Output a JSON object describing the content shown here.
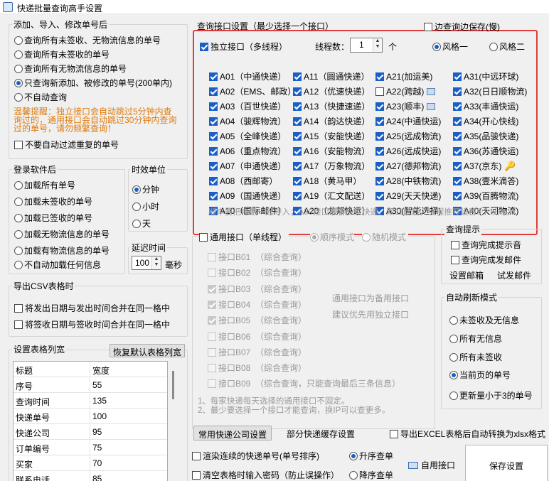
{
  "window": {
    "title": "快递批量查询高手设置"
  },
  "add": {
    "legend": "添加、导入、修改单号后",
    "options": [
      "查询所有未签收、无物流信息的单号",
      "查询所有未签收的单号",
      "查询所有无物流信息的单号",
      "只查询新添加、被修改的单号(200单内)",
      "不自动查询"
    ],
    "selected": 3,
    "warning": [
      "温馨提醒：独立接口会自动跳过5分钟内查",
      "询过的，通用接口会自动跳过30分钟内查询",
      "过的单号，请勿频繁查询！"
    ],
    "nofilter": "不要自动过滤重复的单号"
  },
  "login": {
    "legend": "登录软件后",
    "options": [
      "加载所有单号",
      "加载未签收的单号",
      "加载已签收的单号",
      "加载无物流信息的单号",
      "加载有物流信息的单号",
      "不自动加载任何信息"
    ]
  },
  "timeunit": {
    "legend": "时效单位",
    "options": [
      "分钟",
      "小时",
      "天"
    ],
    "selected": 0
  },
  "delay": {
    "legend": "延迟时间",
    "value": "100",
    "unit": "毫秒"
  },
  "csv": {
    "legend": "导出CSV表格时",
    "options": [
      "将发出日期与发出时间合并在同一格中",
      "将签收日期与签收时间合并在同一格中"
    ]
  },
  "colwidth": {
    "legend": "设置表格列宽",
    "reset": "恢复默认表格列宽",
    "headers": [
      "标题",
      "宽度"
    ],
    "rows": [
      [
        "序号",
        "55"
      ],
      [
        "查询时间",
        "135"
      ],
      [
        "快递单号",
        "100"
      ],
      [
        "快递公司",
        "95"
      ],
      [
        "订单编号",
        "75"
      ],
      [
        "买家",
        "70"
      ],
      [
        "联系电话",
        "85"
      ]
    ]
  },
  "api": {
    "legend": "查询接口设置（最少选择一个接口）",
    "saveWhileQuery": "边查询边保存(慢)",
    "independent": "独立接口（多线程）",
    "threadsLabel": "线程数：",
    "threads": "1",
    "threadsUnit": "个",
    "style1": "风格一",
    "style2": "风格二",
    "col1": [
      "A01（中通快递）",
      "A02（EMS、邮政）",
      "A03（百世快递）",
      "A04（骏辉物流）",
      "A05（全峰快递）",
      "A06（重点物流）",
      "A07（申通快递）",
      "A08（西邮寄）",
      "A09（国通快递）",
      "A10（国际邮件）"
    ],
    "col2": [
      "A11（圆通快递）",
      "A12（优速快递）",
      "A13（快捷速递）",
      "A14（韵达快递）",
      "A15（安能快递）",
      "A16（安能物流）",
      "A17（万象物流）",
      "A18（黄马甲）",
      "A19（汇文配送）",
      "A20（龙邦快运）"
    ],
    "col3": [
      "A21(加运美)",
      "A22(跨越)",
      "A23(顺丰)",
      "A24(中通快运)",
      "A25(远成物流)",
      "A26(远成快运)",
      "A27(德邦物流)",
      "A28(中铁物流)",
      "A29(天天快递)",
      "A30(智能选择)"
    ],
    "col4": [
      "A31(中远环球)",
      "A32(日日顺物流)",
      "A33(丰通快运)",
      "A34(开心快线)",
      "A35(品骏快递)",
      "A36(苏通快运)",
      "A37(京东)",
      "A38(壹米滴答)",
      "A39(百腾物流)",
      "A40(天河物流)"
    ],
    "note": "顺丰要把电话一起导入；A30接口兼容多家快递。双11前后，线程推荐设置5个以内。"
  },
  "general": {
    "label": "通用接口（单线程）",
    "mode1": "顺序模式",
    "mode2": "随机模式",
    "items": [
      "接口B01  （综合查询）",
      "接口B02  （综合查询）",
      "接口B03  （综合查询）",
      "接口B04  （综合查询）",
      "接口B05  （综合查询）",
      "接口B06  （综合查询）",
      "接口B07  （综合查询）",
      "接口B08  （综合查询）",
      "接口B09  （综合查询，只能查询最后三条信息）"
    ],
    "checked": [
      false,
      false,
      true,
      true,
      true,
      false,
      false,
      false,
      false
    ],
    "hint1": "通用接口为备用接口",
    "hint2": "建议优先用独立接口",
    "note1": "1、每家快递每天选择的通用接口不固定。",
    "note2": "2、最少要选择一个接口才能查询，换IP可以查更多。"
  },
  "prompt": {
    "legend": "查询提示",
    "sound": "查询完成提示音",
    "mail": "查询完成发邮件",
    "setmail": "设置邮箱",
    "testmail": "试发邮件"
  },
  "refresh": {
    "legend": "自动刷新模式",
    "options": [
      "未签收及无信息",
      "所有无信息",
      "所有未签收",
      "当前页的单号",
      "更新量小于3的单号"
    ],
    "selected": 3
  },
  "bottom": {
    "common": "常用快递公司设置",
    "cache": "部分快递缓存设置",
    "exportXlsx": "导出EXCEL表格后自动转换为xlsx格式",
    "render": "渲染连续的快递单号(单号排序)",
    "asc": "升序查单",
    "clearpw": "清空表格时输入密码（防止误操作）",
    "desc": "降序查单",
    "customApi": "自用接口",
    "save": "保存设置"
  }
}
